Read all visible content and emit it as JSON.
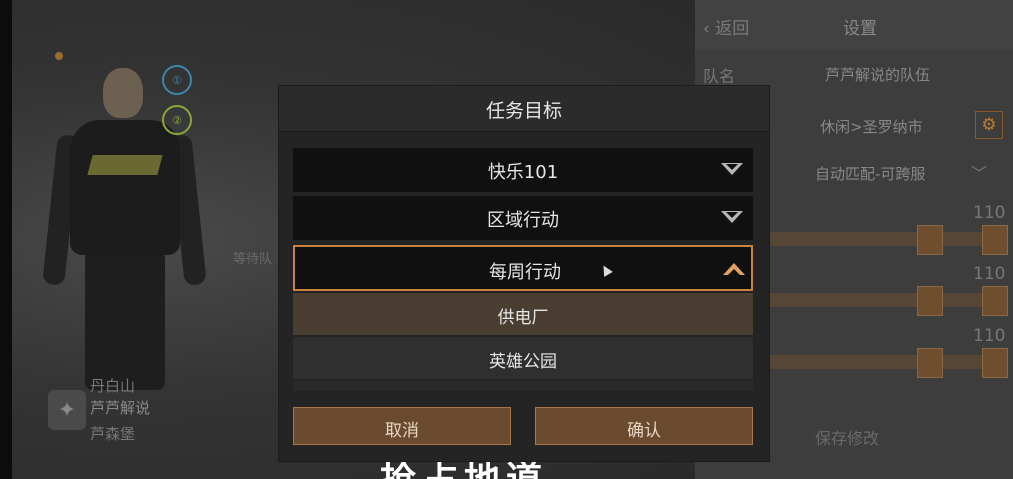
{
  "background": {
    "player": {
      "line1": "丹白山",
      "line2": "芦芦解说",
      "line3": "芦森堡"
    },
    "waiting_text": "等待队",
    "badges": [
      "①",
      "②"
    ]
  },
  "settings": {
    "back_label": "返回",
    "title": "设置",
    "team_name_label": "队名",
    "team_name_value": "芦芦解说的队伍",
    "mode_value": "休闲>圣罗纳市",
    "match_value": "自动匹配-可跨服",
    "numbers": [
      "110",
      "110",
      "110"
    ],
    "save_label": "保存修改"
  },
  "modal": {
    "title": "任务目标",
    "dropdowns": [
      {
        "label": "快乐101",
        "expanded": false
      },
      {
        "label": "区域行动",
        "expanded": false
      },
      {
        "label": "每周行动",
        "expanded": true
      }
    ],
    "options": [
      {
        "label": "供电厂",
        "selected": true
      },
      {
        "label": "英雄公园",
        "selected": false
      }
    ],
    "cancel_label": "取消",
    "confirm_label": "确认"
  },
  "subtitle": "抢占地道",
  "colors": {
    "accent": "#c8843c",
    "button_bg": "#6a4b30",
    "modal_bg": "#242424"
  }
}
